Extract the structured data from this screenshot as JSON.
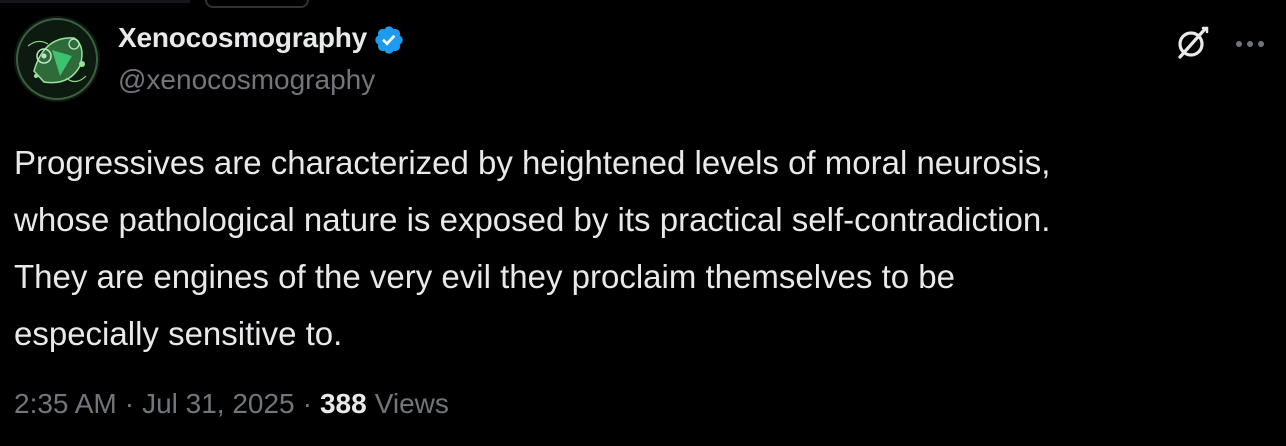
{
  "author": {
    "display_name": "Xenocosmography",
    "handle": "@xenocosmography",
    "verified": true,
    "verified_color": "#1d9bf0"
  },
  "icons": {
    "avatar": "avatar-image",
    "verified": "verified-badge-icon",
    "grok": "grok-icon",
    "more": "more-options-icon"
  },
  "tweet": {
    "lines": [
      "Progressives are characterized by heightened levels of moral neurosis,",
      "whose pathological nature is exposed by its practical self-contradiction.",
      "They are engines of the very evil they proclaim themselves to be",
      "especially sensitive to."
    ]
  },
  "meta": {
    "time": "2:35 AM",
    "separator": "·",
    "date": "Jul 31, 2025",
    "views_count": "388",
    "views_label": "Views"
  },
  "colors": {
    "background": "#000000",
    "text_primary": "#e7e9ea",
    "text_secondary": "#71767b"
  }
}
